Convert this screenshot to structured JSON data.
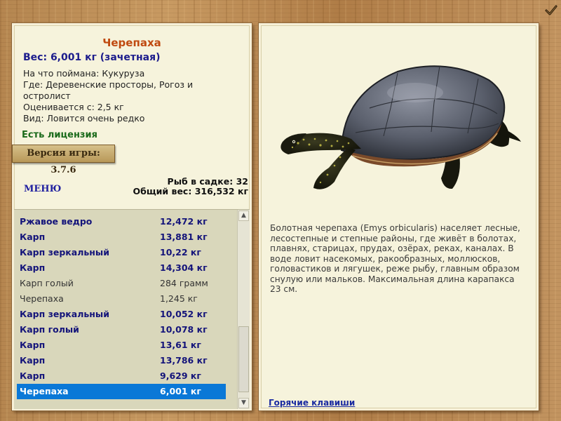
{
  "fish": {
    "name": "Черепаха",
    "weight_line": "Вес: 6,001 кг (зачетная)",
    "bait": "На что поймана: Кукуруза",
    "where": "Где: Деревенские просторы, Рогоз и остролист",
    "price": "Оценивается с: 2,5 кг",
    "kind": "Вид: Ловится очень редко",
    "license": "Есть лицензия"
  },
  "version_label": "Версия игры: 3.7.6",
  "menu_label": "МЕНЮ",
  "cage": {
    "fish_count": "Рыб в садке: 32",
    "total_weight": "Общий вес: 316,532 кг"
  },
  "catch_list": [
    {
      "name": "Ржавое ведро",
      "weight": "12,472 кг",
      "style": "hi"
    },
    {
      "name": "Карп",
      "weight": "13,881 кг",
      "style": "hi"
    },
    {
      "name": "Карп зеркальный",
      "weight": "10,22 кг",
      "style": "hi"
    },
    {
      "name": "Карп",
      "weight": "14,304 кг",
      "style": "hi"
    },
    {
      "name": "Карп голый",
      "weight": "284 грамм",
      "style": "lo"
    },
    {
      "name": "Черепаха",
      "weight": "1,245 кг",
      "style": "lo"
    },
    {
      "name": "Карп зеркальный",
      "weight": "10,052 кг",
      "style": "hi"
    },
    {
      "name": "Карп голый",
      "weight": "10,078 кг",
      "style": "hi"
    },
    {
      "name": "Карп",
      "weight": "13,61 кг",
      "style": "hi"
    },
    {
      "name": "Карп",
      "weight": "13,786 кг",
      "style": "hi"
    },
    {
      "name": "Карп",
      "weight": "9,629 кг",
      "style": "hi"
    },
    {
      "name": "Черепаха",
      "weight": "6,001 кг",
      "style": "sel"
    }
  ],
  "description": "Болотная черепаха (Emys orbicularis) населяет лесные, лесостепные и степные районы, где живёт в болотах, плавнях, старицах, прудах, озёрах, реках, каналах. В воде ловит насекомых, ракообразных, моллюсков, головастиков и лягушек, реже рыбу, главным образом снулую или мальков. Максимальная длина карапакса 23 см.",
  "hotkeys_label": "Горячие клавиши",
  "icons": {
    "close": "checkmark-icon",
    "scroll_up": "scroll-up-arrow-icon",
    "scroll_down": "scroll-down-arrow-icon"
  },
  "colors": {
    "title": "#c04a10",
    "weight": "#1c1c8c",
    "license": "#1a6a1a",
    "selection": "#0a78d7"
  }
}
